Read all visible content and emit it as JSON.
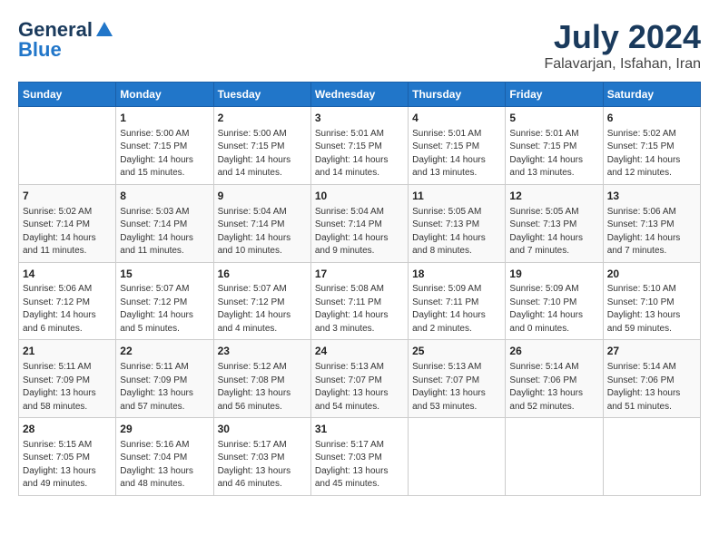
{
  "header": {
    "logo_line1": "General",
    "logo_line2": "Blue",
    "month": "July 2024",
    "location": "Falavarjan, Isfahan, Iran"
  },
  "weekdays": [
    "Sunday",
    "Monday",
    "Tuesday",
    "Wednesday",
    "Thursday",
    "Friday",
    "Saturday"
  ],
  "weeks": [
    [
      {
        "day": "",
        "info": ""
      },
      {
        "day": "1",
        "info": "Sunrise: 5:00 AM\nSunset: 7:15 PM\nDaylight: 14 hours\nand 15 minutes."
      },
      {
        "day": "2",
        "info": "Sunrise: 5:00 AM\nSunset: 7:15 PM\nDaylight: 14 hours\nand 14 minutes."
      },
      {
        "day": "3",
        "info": "Sunrise: 5:01 AM\nSunset: 7:15 PM\nDaylight: 14 hours\nand 14 minutes."
      },
      {
        "day": "4",
        "info": "Sunrise: 5:01 AM\nSunset: 7:15 PM\nDaylight: 14 hours\nand 13 minutes."
      },
      {
        "day": "5",
        "info": "Sunrise: 5:01 AM\nSunset: 7:15 PM\nDaylight: 14 hours\nand 13 minutes."
      },
      {
        "day": "6",
        "info": "Sunrise: 5:02 AM\nSunset: 7:15 PM\nDaylight: 14 hours\nand 12 minutes."
      }
    ],
    [
      {
        "day": "7",
        "info": "Sunrise: 5:02 AM\nSunset: 7:14 PM\nDaylight: 14 hours\nand 11 minutes."
      },
      {
        "day": "8",
        "info": "Sunrise: 5:03 AM\nSunset: 7:14 PM\nDaylight: 14 hours\nand 11 minutes."
      },
      {
        "day": "9",
        "info": "Sunrise: 5:04 AM\nSunset: 7:14 PM\nDaylight: 14 hours\nand 10 minutes."
      },
      {
        "day": "10",
        "info": "Sunrise: 5:04 AM\nSunset: 7:14 PM\nDaylight: 14 hours\nand 9 minutes."
      },
      {
        "day": "11",
        "info": "Sunrise: 5:05 AM\nSunset: 7:13 PM\nDaylight: 14 hours\nand 8 minutes."
      },
      {
        "day": "12",
        "info": "Sunrise: 5:05 AM\nSunset: 7:13 PM\nDaylight: 14 hours\nand 7 minutes."
      },
      {
        "day": "13",
        "info": "Sunrise: 5:06 AM\nSunset: 7:13 PM\nDaylight: 14 hours\nand 7 minutes."
      }
    ],
    [
      {
        "day": "14",
        "info": "Sunrise: 5:06 AM\nSunset: 7:12 PM\nDaylight: 14 hours\nand 6 minutes."
      },
      {
        "day": "15",
        "info": "Sunrise: 5:07 AM\nSunset: 7:12 PM\nDaylight: 14 hours\nand 5 minutes."
      },
      {
        "day": "16",
        "info": "Sunrise: 5:07 AM\nSunset: 7:12 PM\nDaylight: 14 hours\nand 4 minutes."
      },
      {
        "day": "17",
        "info": "Sunrise: 5:08 AM\nSunset: 7:11 PM\nDaylight: 14 hours\nand 3 minutes."
      },
      {
        "day": "18",
        "info": "Sunrise: 5:09 AM\nSunset: 7:11 PM\nDaylight: 14 hours\nand 2 minutes."
      },
      {
        "day": "19",
        "info": "Sunrise: 5:09 AM\nSunset: 7:10 PM\nDaylight: 14 hours\nand 0 minutes."
      },
      {
        "day": "20",
        "info": "Sunrise: 5:10 AM\nSunset: 7:10 PM\nDaylight: 13 hours\nand 59 minutes."
      }
    ],
    [
      {
        "day": "21",
        "info": "Sunrise: 5:11 AM\nSunset: 7:09 PM\nDaylight: 13 hours\nand 58 minutes."
      },
      {
        "day": "22",
        "info": "Sunrise: 5:11 AM\nSunset: 7:09 PM\nDaylight: 13 hours\nand 57 minutes."
      },
      {
        "day": "23",
        "info": "Sunrise: 5:12 AM\nSunset: 7:08 PM\nDaylight: 13 hours\nand 56 minutes."
      },
      {
        "day": "24",
        "info": "Sunrise: 5:13 AM\nSunset: 7:07 PM\nDaylight: 13 hours\nand 54 minutes."
      },
      {
        "day": "25",
        "info": "Sunrise: 5:13 AM\nSunset: 7:07 PM\nDaylight: 13 hours\nand 53 minutes."
      },
      {
        "day": "26",
        "info": "Sunrise: 5:14 AM\nSunset: 7:06 PM\nDaylight: 13 hours\nand 52 minutes."
      },
      {
        "day": "27",
        "info": "Sunrise: 5:14 AM\nSunset: 7:06 PM\nDaylight: 13 hours\nand 51 minutes."
      }
    ],
    [
      {
        "day": "28",
        "info": "Sunrise: 5:15 AM\nSunset: 7:05 PM\nDaylight: 13 hours\nand 49 minutes."
      },
      {
        "day": "29",
        "info": "Sunrise: 5:16 AM\nSunset: 7:04 PM\nDaylight: 13 hours\nand 48 minutes."
      },
      {
        "day": "30",
        "info": "Sunrise: 5:17 AM\nSunset: 7:03 PM\nDaylight: 13 hours\nand 46 minutes."
      },
      {
        "day": "31",
        "info": "Sunrise: 5:17 AM\nSunset: 7:03 PM\nDaylight: 13 hours\nand 45 minutes."
      },
      {
        "day": "",
        "info": ""
      },
      {
        "day": "",
        "info": ""
      },
      {
        "day": "",
        "info": ""
      }
    ]
  ]
}
